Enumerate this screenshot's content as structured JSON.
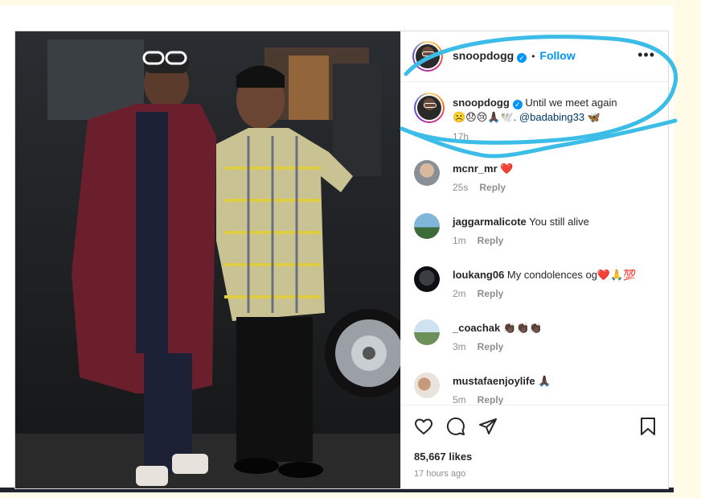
{
  "post": {
    "author": "snoopdogg",
    "follow_label": "Follow",
    "separator": "•",
    "more_label": "•••",
    "caption_text": "Until we meet again",
    "caption_emojis": "☹️😞😢🙏🏿🕊️.",
    "caption_mention": "@badabing33",
    "caption_trailing_emoji": "🦋",
    "caption_time": "17h",
    "likes": "85,667 likes",
    "time_ago": "17 hours ago"
  },
  "comments": [
    {
      "user": "mcnr_mr",
      "text": "❤️",
      "time": "25s",
      "reply": "Reply"
    },
    {
      "user": "jaggarmalicote",
      "text": "You still alive",
      "time": "1m",
      "reply": "Reply"
    },
    {
      "user": "loukang06",
      "text": "My condolences og❤️🙏💯",
      "time": "2m",
      "reply": "Reply"
    },
    {
      "user": "_coachak",
      "text": "👏🏿👏🏿👏🏿",
      "time": "3m",
      "reply": "Reply"
    },
    {
      "user": "mustafaenjoylife",
      "text": "🙏🏿",
      "time": "5m",
      "reply": "Reply"
    }
  ],
  "icons": [
    "heart-icon",
    "comment-icon",
    "share-icon",
    "bookmark-icon",
    "more-icon",
    "verified-badge-icon"
  ],
  "colors": {
    "accent": "#0095f6",
    "annotation_stroke": "#3bbde8",
    "text_primary": "#262626",
    "text_secondary": "#8e8e8e"
  }
}
